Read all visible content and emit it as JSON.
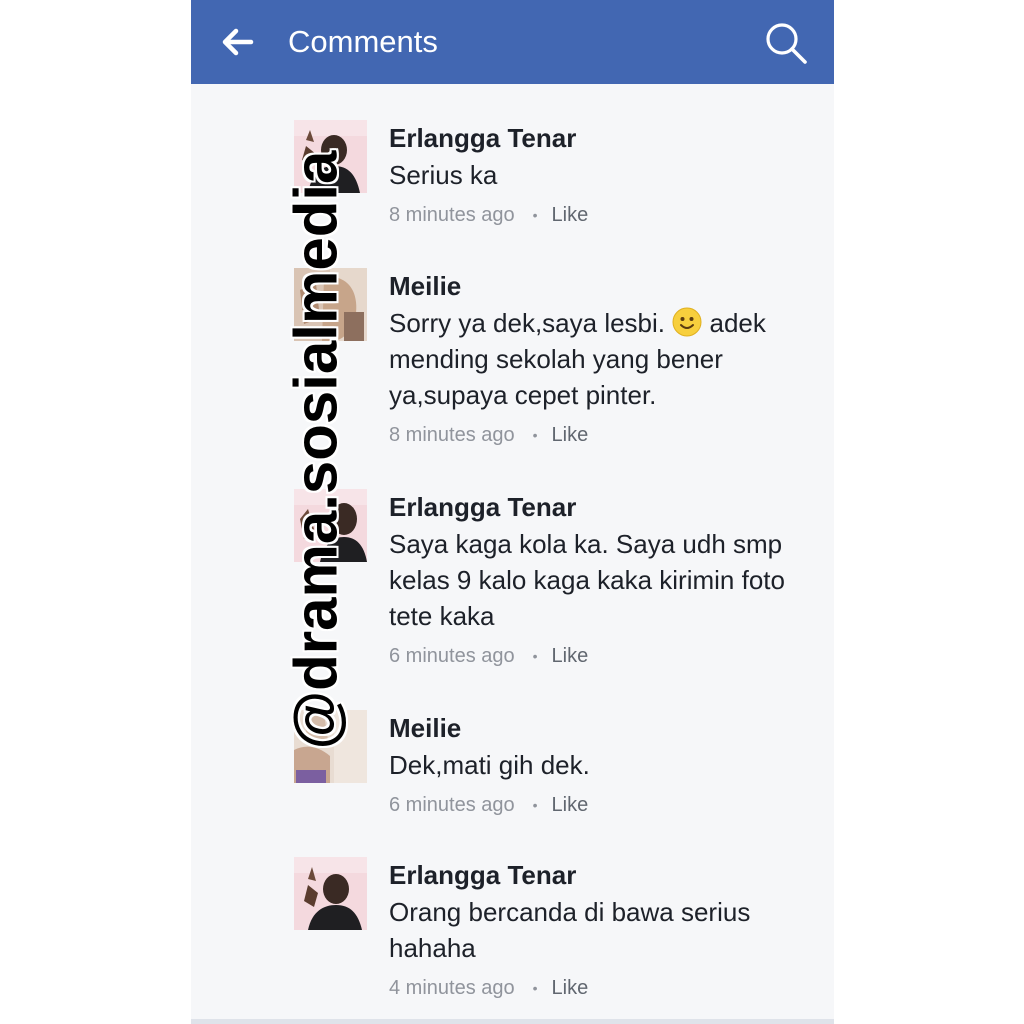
{
  "header": {
    "title": "Comments",
    "back_icon": "arrow-left-icon",
    "search_icon": "search-icon",
    "color": "#4267b2"
  },
  "comments": [
    {
      "author": "Erlangga Tenar",
      "text": "Serius ka",
      "time": "8 minutes ago",
      "like": "Like"
    },
    {
      "author": "Meilie",
      "text_before_emoji": "Sorry ya dek,saya lesbi.",
      "emoji": "smiley-emoji",
      "text_after_emoji": "adek mending sekolah yang bener ya,supaya cepet pinter.",
      "time": "8 minutes ago",
      "like": "Like"
    },
    {
      "author": "Erlangga Tenar",
      "text": "Saya kaga kola ka. Saya udh smp kelas 9 kalo kaga kaka kirimin foto tete kaka",
      "time": "6 minutes ago",
      "like": "Like"
    },
    {
      "author": "Meilie",
      "text": "Dek,mati gih dek.",
      "time": "6 minutes ago",
      "like": "Like"
    },
    {
      "author": "Erlangga Tenar",
      "text": "Orang bercanda di bawa serius hahaha",
      "time": "4 minutes ago",
      "like": "Like"
    }
  ],
  "watermark": "@drama.sosialmedia"
}
